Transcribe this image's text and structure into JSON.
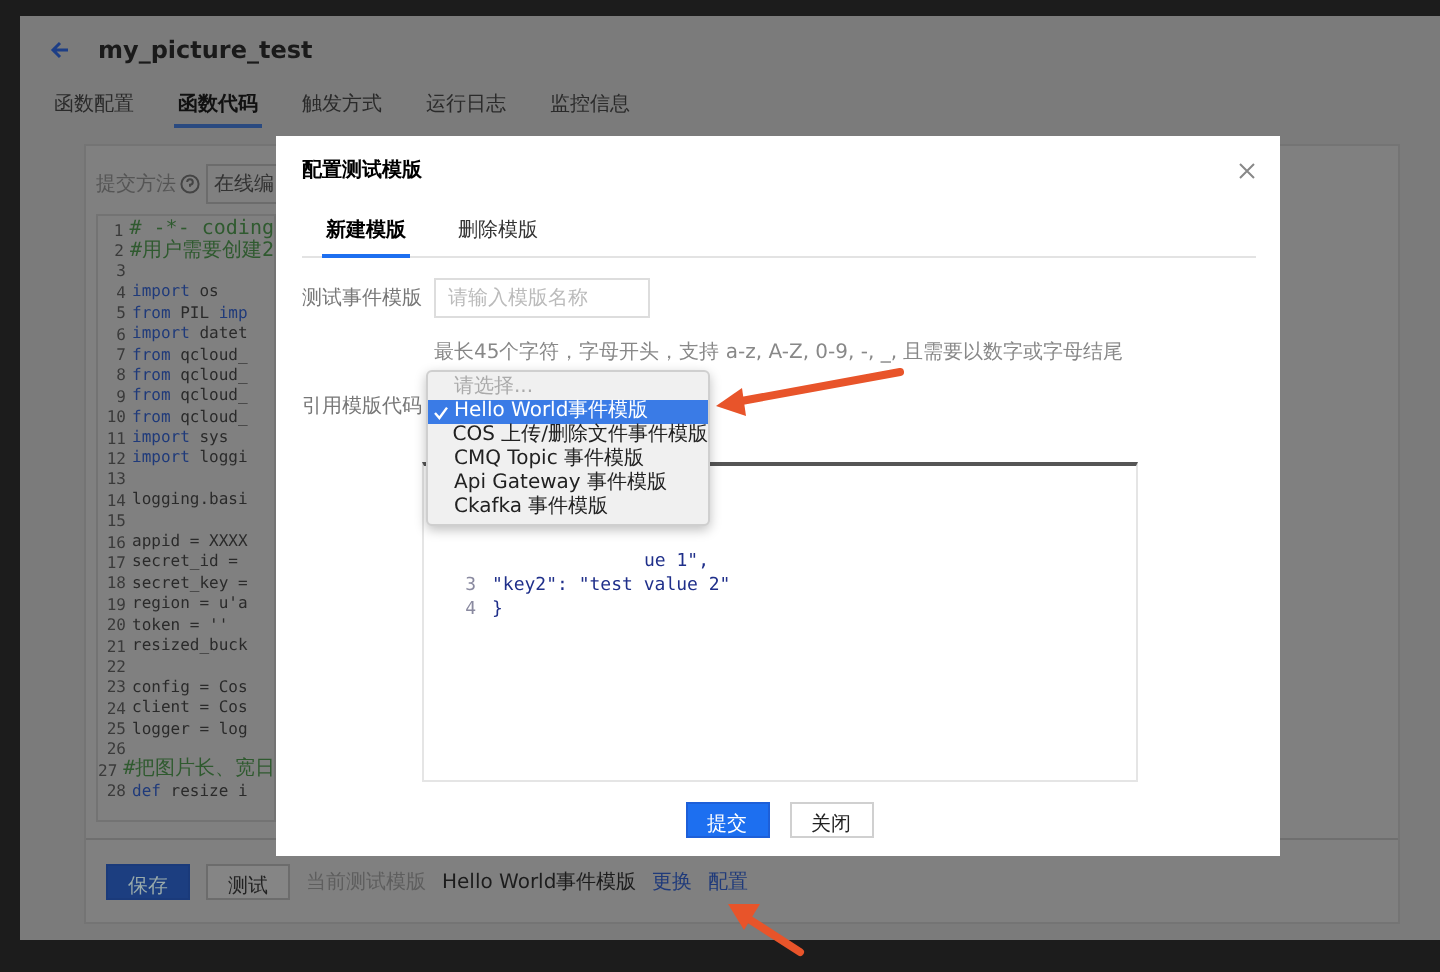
{
  "title": "my_picture_test",
  "tabs": [
    {
      "label": "函数配置",
      "selected": false
    },
    {
      "label": "函数代码",
      "selected": true
    },
    {
      "label": "触发方式",
      "selected": false
    },
    {
      "label": "运行日志",
      "selected": false
    },
    {
      "label": "监控信息",
      "selected": false
    }
  ],
  "submit_method": {
    "label": "提交方法",
    "value": "在线编"
  },
  "code_lines": [
    {
      "number": "1",
      "segments": [
        {
          "kind": "comment",
          "text": "# -*- coding"
        }
      ]
    },
    {
      "number": "2",
      "segments": [
        {
          "kind": "comment",
          "text": "#用户需要创建2"
        }
      ]
    },
    {
      "number": "3"
    },
    {
      "number": "4",
      "segments": [
        {
          "kind": "keyword",
          "text": "import"
        },
        {
          "kind": "plain",
          "text": " os"
        }
      ]
    },
    {
      "number": "5",
      "segments": [
        {
          "kind": "keyword",
          "text": "from"
        },
        {
          "kind": "plain",
          "text": " PIL "
        },
        {
          "kind": "keyword",
          "text": "imp"
        }
      ]
    },
    {
      "number": "6",
      "segments": [
        {
          "kind": "keyword",
          "text": "import"
        },
        {
          "kind": "plain",
          "text": " datet"
        }
      ]
    },
    {
      "number": "7",
      "segments": [
        {
          "kind": "keyword",
          "text": "from"
        },
        {
          "kind": "plain",
          "text": " qcloud_"
        }
      ]
    },
    {
      "number": "8",
      "segments": [
        {
          "kind": "keyword",
          "text": "from"
        },
        {
          "kind": "plain",
          "text": " qcloud_"
        }
      ]
    },
    {
      "number": "9",
      "segments": [
        {
          "kind": "keyword",
          "text": "from"
        },
        {
          "kind": "plain",
          "text": " qcloud_"
        }
      ]
    },
    {
      "number": "10",
      "segments": [
        {
          "kind": "keyword",
          "text": "from"
        },
        {
          "kind": "plain",
          "text": " qcloud_"
        }
      ]
    },
    {
      "number": "11",
      "segments": [
        {
          "kind": "keyword",
          "text": "import"
        },
        {
          "kind": "plain",
          "text": " sys"
        }
      ]
    },
    {
      "number": "12",
      "segments": [
        {
          "kind": "keyword",
          "text": "import"
        },
        {
          "kind": "plain",
          "text": " loggi"
        }
      ]
    },
    {
      "number": "13"
    },
    {
      "number": "14",
      "segments": [
        {
          "kind": "plain",
          "text": "logging.basi"
        }
      ]
    },
    {
      "number": "15"
    },
    {
      "number": "16",
      "segments": [
        {
          "kind": "plain",
          "text": "appid = XXXX"
        }
      ]
    },
    {
      "number": "17",
      "segments": [
        {
          "kind": "plain",
          "text": "secret_id ="
        }
      ]
    },
    {
      "number": "18",
      "segments": [
        {
          "kind": "plain",
          "text": "secret_key ="
        }
      ]
    },
    {
      "number": "19",
      "segments": [
        {
          "kind": "plain",
          "text": "region = u'a"
        }
      ]
    },
    {
      "number": "20",
      "segments": [
        {
          "kind": "plain",
          "text": "token = ''"
        }
      ]
    },
    {
      "number": "21",
      "segments": [
        {
          "kind": "plain",
          "text": "resized_buck"
        }
      ]
    },
    {
      "number": "22"
    },
    {
      "number": "23",
      "segments": [
        {
          "kind": "plain",
          "text": "config = Cos"
        }
      ]
    },
    {
      "number": "24",
      "segments": [
        {
          "kind": "plain",
          "text": "client = Cos"
        }
      ]
    },
    {
      "number": "25",
      "segments": [
        {
          "kind": "plain",
          "text": "logger = log"
        }
      ]
    },
    {
      "number": "26"
    },
    {
      "number": "27",
      "segments": [
        {
          "kind": "comment",
          "text": "#把图片长、宽日"
        }
      ]
    },
    {
      "number": "28",
      "segments": [
        {
          "kind": "keyword",
          "text": "def"
        },
        {
          "kind": "plain",
          "text": " resize i"
        }
      ]
    }
  ],
  "bottom_bar": {
    "save": "保存",
    "test": "测试",
    "current_label": "当前测试模版",
    "current_value": "Hello World事件模版",
    "links": [
      "更换",
      "配置"
    ]
  },
  "modal": {
    "title": "配置测试模版",
    "tabs": [
      {
        "label": "新建模版",
        "selected": true
      },
      {
        "label": "删除模版",
        "selected": false
      }
    ],
    "name_field": {
      "label": "测试事件模版",
      "placeholder": "请输入模版名称"
    },
    "hint": "最长45个字符，字母开头，支持 a-z, A-Z, 0-9, -, _, 且需要以数字或字母结尾",
    "template_field": {
      "label": "引用模版代码",
      "options": [
        {
          "label": "请选择...",
          "disabled": true,
          "selected": false
        },
        {
          "label": "Hello World事件模版",
          "disabled": false,
          "selected": true
        },
        {
          "label": "COS 上传/删除文件事件模版",
          "disabled": false,
          "selected": false
        },
        {
          "label": "CMQ Topic 事件模版",
          "disabled": false,
          "selected": false
        },
        {
          "label": "Api Gateway 事件模版",
          "disabled": false,
          "selected": false
        },
        {
          "label": "Ckafka 事件模版",
          "disabled": false,
          "selected": false
        }
      ]
    },
    "editor_lines": [
      {
        "text": "ue 1\","
      },
      {
        "number": "3",
        "text": "\"key2\": \"test value 2\""
      },
      {
        "number": "4",
        "text": "}"
      }
    ],
    "buttons": [
      {
        "label": "提交",
        "kind": "primary"
      },
      {
        "label": "关闭",
        "kind": "secondary"
      }
    ]
  }
}
